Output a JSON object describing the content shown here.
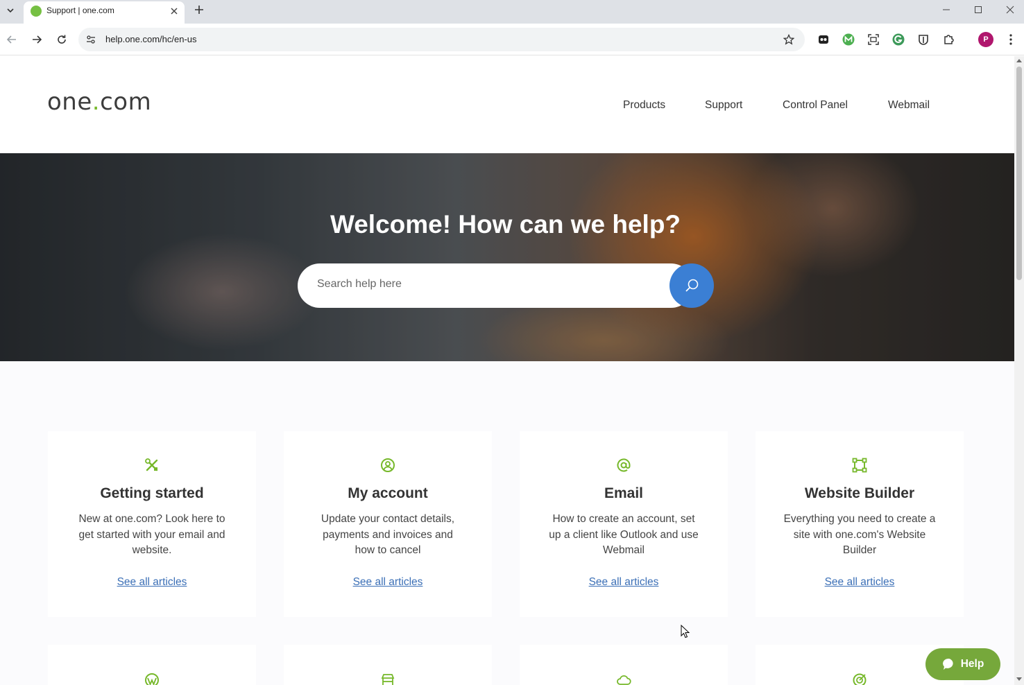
{
  "browser": {
    "tab_title": "Support | one.com",
    "url": "help.one.com/hc/en-us",
    "profile_initial": "P",
    "accent_color": "#dee1e6"
  },
  "header": {
    "logo_text_1": "one",
    "logo_dot": ".",
    "logo_text_2": "com",
    "nav": [
      "Products",
      "Support",
      "Control Panel",
      "Webmail"
    ]
  },
  "hero": {
    "title": "Welcome! How can we help?",
    "search_placeholder": "Search help here",
    "search_value": "",
    "search_button_color": "#3b7fd4"
  },
  "categories": [
    {
      "icon": "tools-icon",
      "title": "Getting started",
      "description": "New at one.com? Look here to get started with your email and website.",
      "link": "See all articles"
    },
    {
      "icon": "user-circle-icon",
      "title": "My account",
      "description": "Update your contact details, payments and invoices and how to cancel",
      "link": "See all articles"
    },
    {
      "icon": "at-sign-icon",
      "title": "Email",
      "description": "How to create an account, set up a client like Outlook and use Webmail",
      "link": "See all articles"
    },
    {
      "icon": "frame-icon",
      "title": "Website Builder",
      "description": "Everything you need to create a site with one.com's Website Builder",
      "link": "See all articles"
    }
  ],
  "more_categories_icons": [
    "wordpress-icon",
    "store-icon",
    "cloud-icon",
    "target-icon"
  ],
  "help_widget": {
    "label": "Help",
    "color": "#76a83b"
  },
  "brand_green": "#76b82a"
}
